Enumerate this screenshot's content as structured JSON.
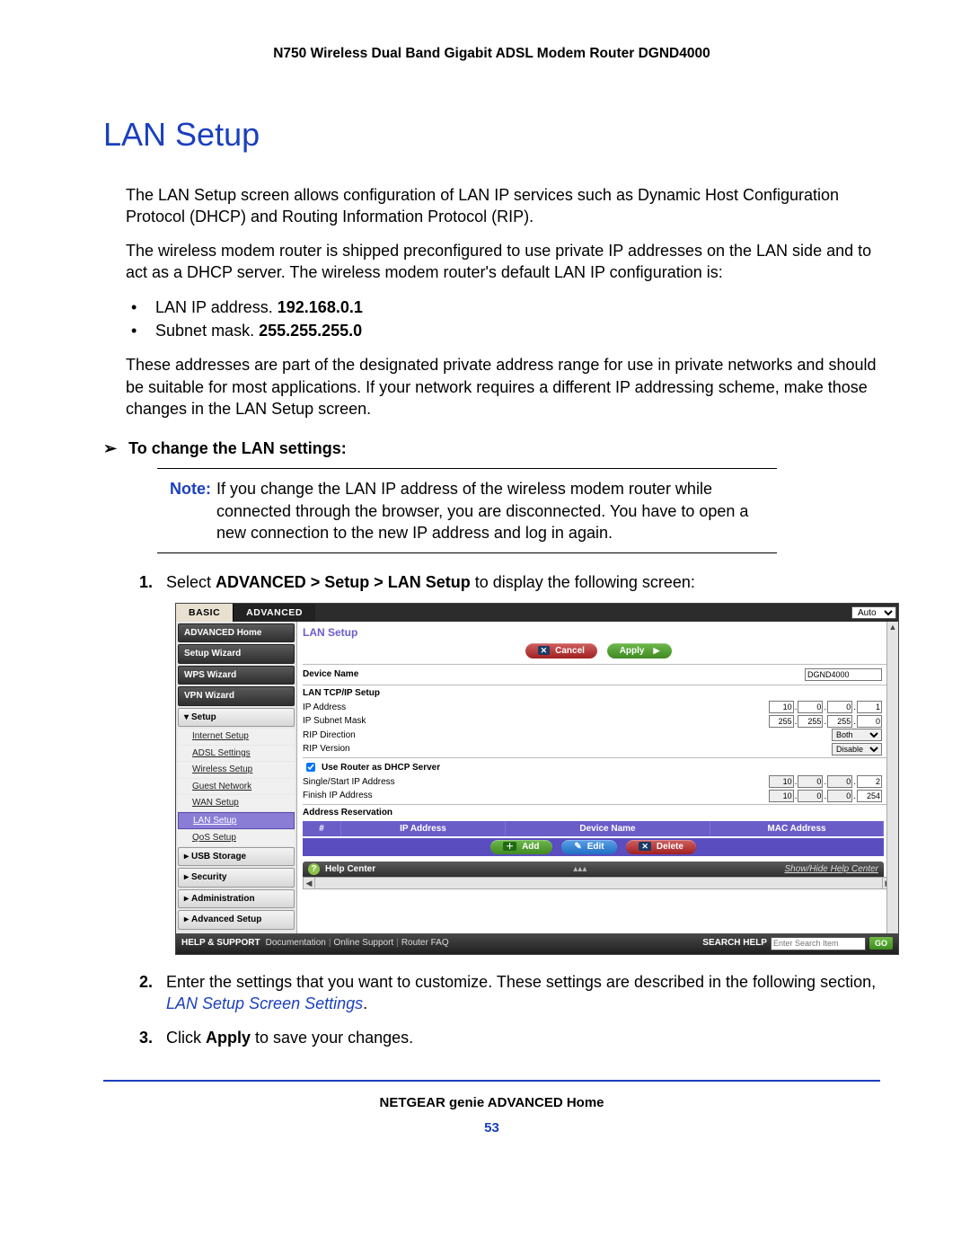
{
  "header": {
    "product": "N750 Wireless Dual Band Gigabit ADSL Modem Router DGND4000"
  },
  "title": "LAN Setup",
  "intro1": "The LAN Setup screen allows configuration of LAN IP services such as Dynamic Host Configuration Protocol (DHCP) and Routing Information Protocol (RIP).",
  "intro2": "The wireless modem router is shipped preconfigured to use private IP addresses on the LAN side and to act as a DHCP server. The wireless modem router's default LAN IP configuration is:",
  "defaults": {
    "ip_label": "LAN IP address. ",
    "ip_value": "192.168.0.1",
    "mask_label": "Subnet mask. ",
    "mask_value": "255.255.255.0"
  },
  "intro3": "These addresses are part of the designated private address range for use in private networks and should be suitable for most applications. If your network requires a different IP addressing scheme, make those changes in the LAN Setup screen.",
  "task": "To change the LAN settings:",
  "note": {
    "label": "Note:",
    "text": "If you change the LAN IP address of the wireless modem router while connected through the browser, you are disconnected. You have to open a new connection to the new IP address and log in again."
  },
  "steps": {
    "s1a": "Select ",
    "s1b": "ADVANCED > Setup > LAN Setup",
    "s1c": " to display the following screen:",
    "s2a": "Enter the settings that you want to customize. These settings are described in the following section, ",
    "s2b": "LAN Setup Screen Settings",
    "s2c": ".",
    "s3a": "Click ",
    "s3b": "Apply",
    "s3c": " to save your changes."
  },
  "ui": {
    "tabs": {
      "basic": "BASIC",
      "advanced": "ADVANCED"
    },
    "lang": "Auto",
    "sidebar": {
      "items": [
        "ADVANCED Home",
        "Setup Wizard",
        "WPS Wizard",
        "VPN Wizard"
      ],
      "setup": {
        "label": "Setup",
        "subs": [
          "Internet Setup",
          "ADSL Settings",
          "Wireless Setup",
          "Guest Network",
          "WAN Setup",
          "LAN Setup",
          "QoS Setup"
        ]
      },
      "rest": [
        "USB Storage",
        "Security",
        "Administration",
        "Advanced Setup"
      ]
    },
    "panel": {
      "title": "LAN Setup",
      "btn_cancel": "Cancel",
      "btn_apply": "Apply",
      "device_name": {
        "label": "Device Name",
        "value": "DGND4000"
      },
      "tcp_title": "LAN TCP/IP Setup",
      "ip_label": "IP Address",
      "ip": [
        "10",
        "0",
        "0",
        "1"
      ],
      "mask_label": "IP Subnet Mask",
      "mask": [
        "255",
        "255",
        "255",
        "0"
      ],
      "rip_dir": {
        "label": "RIP Direction",
        "value": "Both"
      },
      "rip_ver": {
        "label": "RIP Version",
        "value": "Disable"
      },
      "dhcp_label": "Use Router as DHCP Server",
      "start_label": "Single/Start IP Address",
      "start": [
        "10",
        "0",
        "0",
        "2"
      ],
      "finish_label": "Finish IP Address",
      "finish": [
        "10",
        "0",
        "0",
        "254"
      ],
      "reserv": {
        "title": "Address Reservation",
        "th": {
          "n": "#",
          "ip": "IP Address",
          "dn": "Device Name",
          "mac": "MAC Address"
        },
        "add": "Add",
        "edit": "Edit",
        "del": "Delete"
      },
      "help_center": "Help Center",
      "show_hide": "Show/Hide Help Center"
    },
    "footer": {
      "hs": "HELP & SUPPORT",
      "links": [
        "Documentation",
        "Online Support",
        "Router FAQ"
      ],
      "sh": "SEARCH HELP",
      "ph": "Enter Search Item",
      "go": "GO"
    }
  },
  "page_footer": {
    "section": "NETGEAR genie ADVANCED Home",
    "page": "53"
  }
}
